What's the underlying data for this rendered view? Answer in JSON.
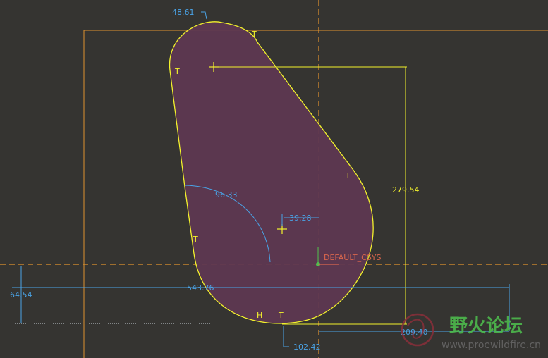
{
  "dimensions": {
    "top_radius": "48.61",
    "angle": "96.33",
    "small_dim": "39.28",
    "height": "279.54",
    "width": "543.76",
    "left_offset": "64.54",
    "bottom_offset": "102.42",
    "right_offset": "209.40"
  },
  "csys_label": "DEFAULT_CSYS",
  "constraints": {
    "t1": "T",
    "t2": "T",
    "t3": "T",
    "t4": "T",
    "t5": "T",
    "h1": "H"
  },
  "watermark": {
    "cn": "野火论坛",
    "url": "www.proewildfire.cn"
  },
  "colors": {
    "background": "#353431",
    "profile_fill": "#5e3851",
    "profile_stroke": "#f3f22c",
    "frame": "#e0922e",
    "dimension_blue": "#4aa3e6",
    "dimension_yellow": "#f3f22c",
    "csys": "#d9664d"
  }
}
